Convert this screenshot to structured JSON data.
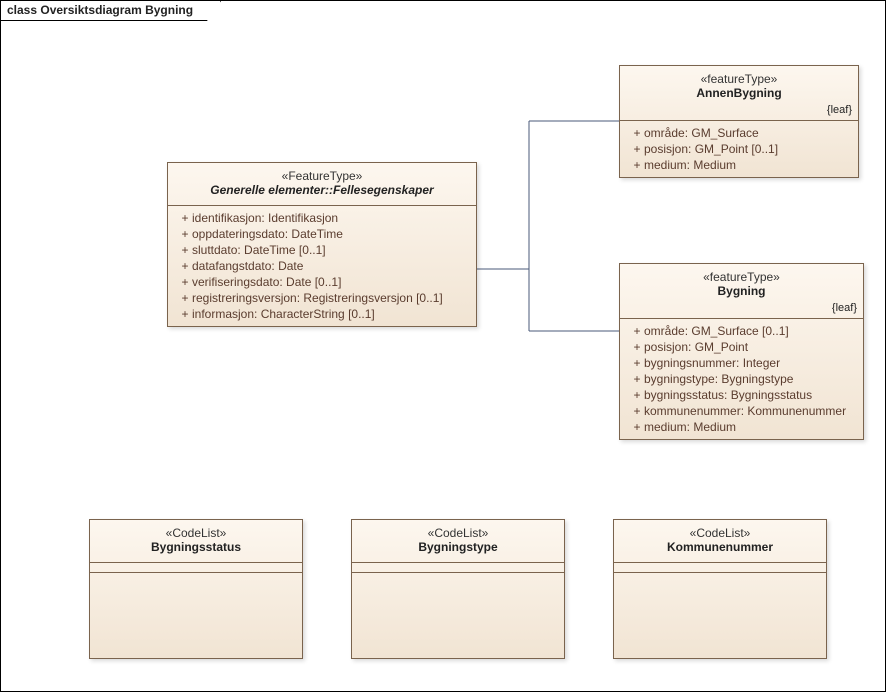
{
  "frame": {
    "title": "class Oversiktsdiagram Bygning"
  },
  "classes": {
    "felles": {
      "stereotype": "«FeatureType»",
      "name": "Generelle elementer::Fellesegenskaper",
      "attrs": [
        {
          "vis": "+",
          "text": "identifikasjon: Identifikasjon"
        },
        {
          "vis": "+",
          "text": "oppdateringsdato: DateTime"
        },
        {
          "vis": "+",
          "text": "sluttdato: DateTime [0..1]"
        },
        {
          "vis": "+",
          "text": "datafangstdato: Date"
        },
        {
          "vis": "+",
          "text": "verifiseringsdato: Date [0..1]"
        },
        {
          "vis": "+",
          "text": "registreringsversjon: Registreringsversjon [0..1]"
        },
        {
          "vis": "+",
          "text": "informasjon: CharacterString [0..1]"
        }
      ]
    },
    "annen": {
      "stereotype": "«featureType»",
      "name": "AnnenBygning",
      "constraint": "{leaf}",
      "attrs": [
        {
          "vis": "+",
          "text": "område: GM_Surface"
        },
        {
          "vis": "+",
          "text": "posisjon: GM_Point [0..1]"
        },
        {
          "vis": "+",
          "text": "medium: Medium"
        }
      ]
    },
    "bygning": {
      "stereotype": "«featureType»",
      "name": "Bygning",
      "constraint": "{leaf}",
      "attrs": [
        {
          "vis": "+",
          "text": "område: GM_Surface [0..1]"
        },
        {
          "vis": "+",
          "text": "posisjon: GM_Point"
        },
        {
          "vis": "+",
          "text": "bygningsnummer: Integer"
        },
        {
          "vis": "+",
          "text": "bygningstype: Bygningstype"
        },
        {
          "vis": "+",
          "text": "bygningsstatus: Bygningsstatus"
        },
        {
          "vis": "+",
          "text": "kommunenummer: Kommunenummer"
        },
        {
          "vis": "+",
          "text": "medium: Medium"
        }
      ]
    },
    "bygningsstatus": {
      "stereotype": "«CodeList»",
      "name": "Bygningsstatus"
    },
    "bygningstype": {
      "stereotype": "«CodeList»",
      "name": "Bygningstype"
    },
    "kommunenummer": {
      "stereotype": "«CodeList»",
      "name": "Kommunenummer"
    }
  }
}
